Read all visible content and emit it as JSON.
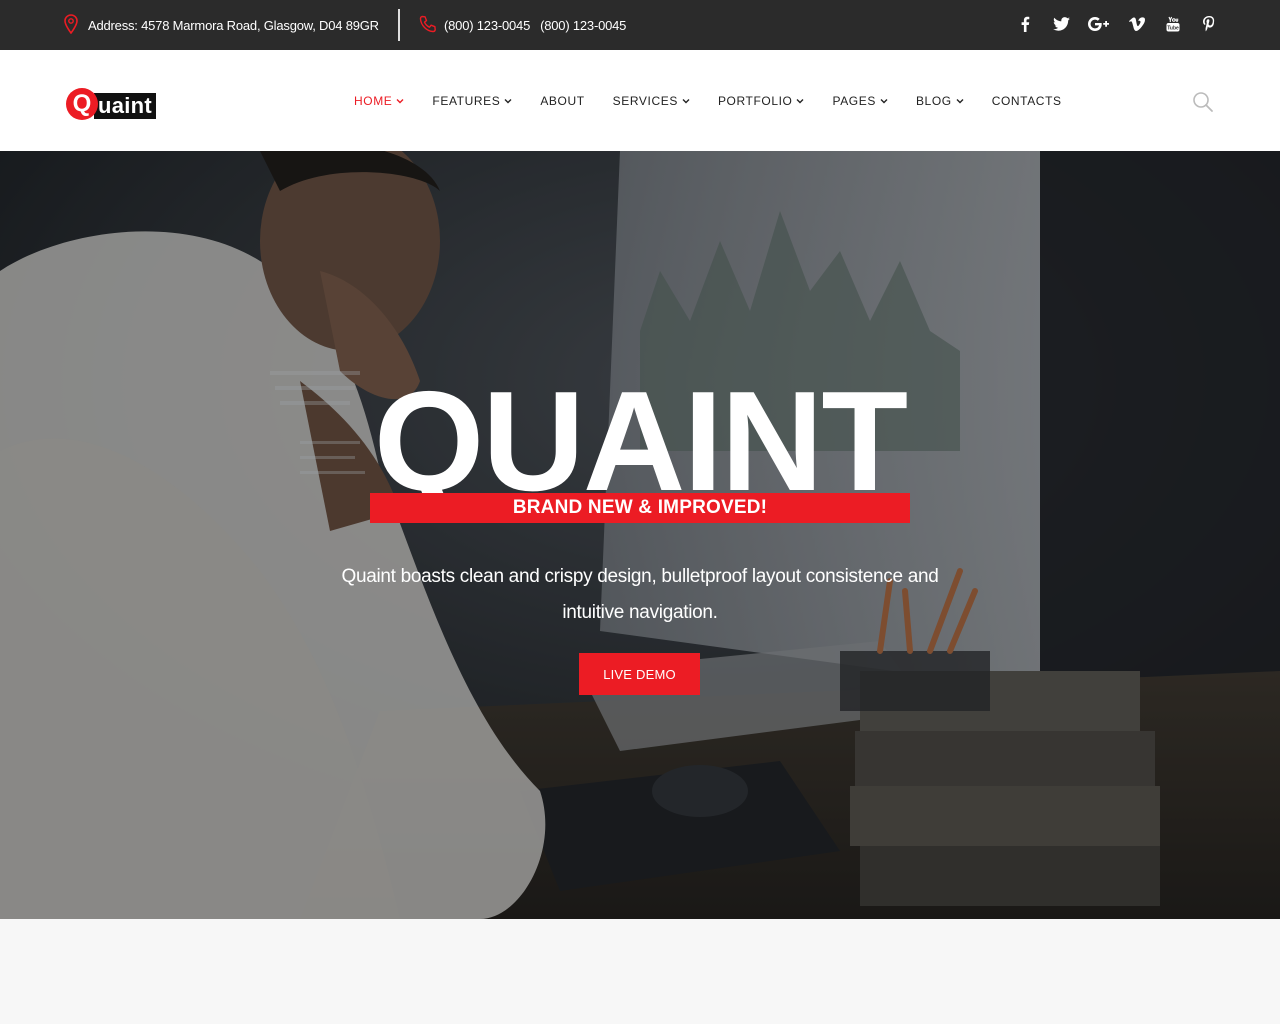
{
  "topbar": {
    "address": "Address: 4578 Marmora Road, Glasgow, D04 89GR",
    "phone_1": "(800) 123-0045",
    "phone_2": "(800) 123-0045",
    "social": [
      "facebook-icon",
      "twitter-icon",
      "google-plus-icon",
      "vimeo-icon",
      "youtube-icon",
      "pinterest-icon"
    ]
  },
  "logo": {
    "letter": "Q",
    "rest": "uaint"
  },
  "nav": {
    "items": [
      {
        "label": "HOME",
        "active": true,
        "dropdown": true
      },
      {
        "label": "FEATURES",
        "dropdown": true
      },
      {
        "label": "ABOUT",
        "dropdown": false
      },
      {
        "label": "SERVICES",
        "dropdown": true
      },
      {
        "label": "PORTFOLIO",
        "dropdown": true
      },
      {
        "label": "PAGES",
        "dropdown": true
      },
      {
        "label": "BLOG",
        "dropdown": true
      },
      {
        "label": "CONTACTS",
        "dropdown": false
      }
    ]
  },
  "hero": {
    "title": "QUAINT",
    "ribbon": "BRAND NEW & IMPROVED!",
    "description": "Quaint boasts clean and crispy design, bulletproof layout consistence and intuitive navigation.",
    "cta": "LIVE DEMO"
  },
  "colors": {
    "accent": "#ec1c24",
    "topbar_bg": "#2b2b2b",
    "header_bg": "#ffffff",
    "footer_bg": "#f7f7f7"
  }
}
